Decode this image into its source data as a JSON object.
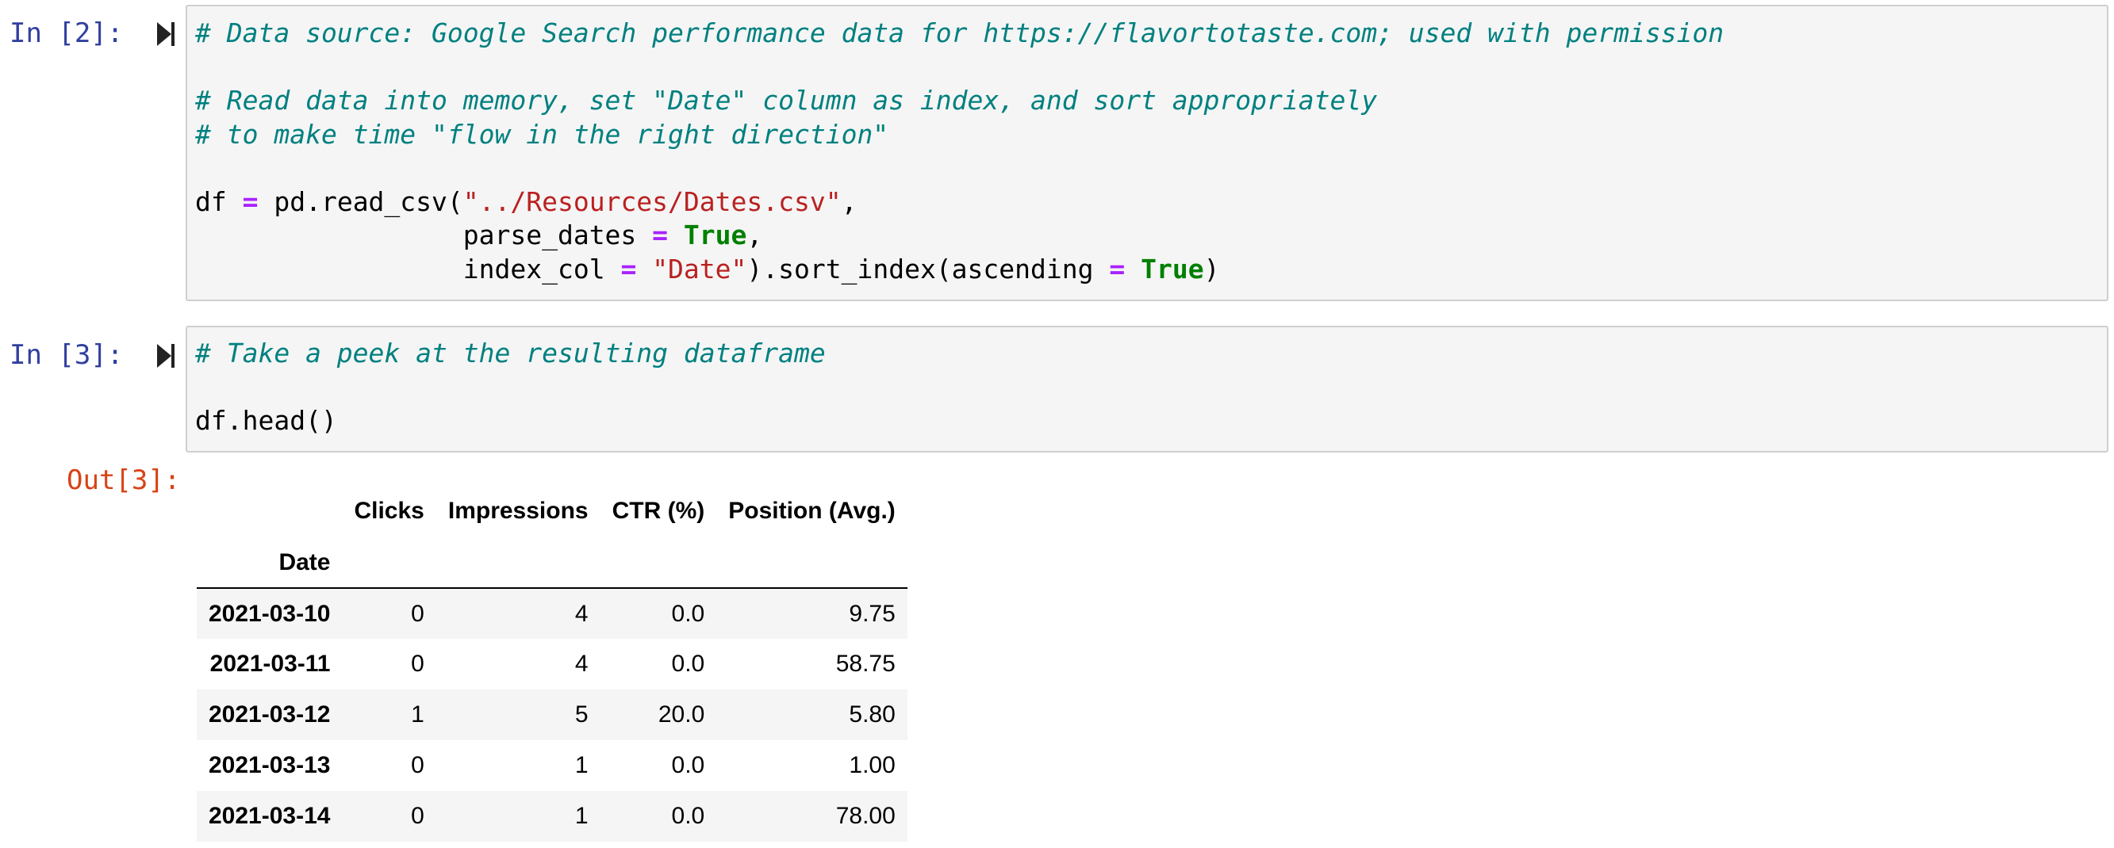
{
  "cells": [
    {
      "prompt": "In [2]:",
      "code_lines": [
        [
          {
            "cls": "cm",
            "text": "# Data source: Google Search performance data for https://flavortotaste.com; used with permission"
          }
        ],
        [],
        [
          {
            "cls": "cm",
            "text": "# Read data into memory, set \"Date\" column as index, and sort appropriately"
          }
        ],
        [
          {
            "cls": "cm",
            "text": "# to make time \"flow in the right direction\""
          }
        ],
        [],
        [
          {
            "cls": "",
            "text": "df "
          },
          {
            "cls": "op",
            "text": "="
          },
          {
            "cls": "",
            "text": " pd.read_csv("
          },
          {
            "cls": "st",
            "text": "\"../Resources/Dates.csv\""
          },
          {
            "cls": "",
            "text": ","
          }
        ],
        [
          {
            "cls": "",
            "text": "                 parse_dates "
          },
          {
            "cls": "op",
            "text": "="
          },
          {
            "cls": "",
            "text": " "
          },
          {
            "cls": "kw",
            "text": "True"
          },
          {
            "cls": "",
            "text": ","
          }
        ],
        [
          {
            "cls": "",
            "text": "                 index_col "
          },
          {
            "cls": "op",
            "text": "="
          },
          {
            "cls": "",
            "text": " "
          },
          {
            "cls": "st",
            "text": "\"Date\""
          },
          {
            "cls": "",
            "text": ").sort_index(ascending "
          },
          {
            "cls": "op",
            "text": "="
          },
          {
            "cls": "",
            "text": " "
          },
          {
            "cls": "kw",
            "text": "True"
          },
          {
            "cls": "",
            "text": ")"
          }
        ]
      ]
    },
    {
      "prompt": "In [3]:",
      "code_lines": [
        [
          {
            "cls": "cm",
            "text": "# Take a peek at the resulting dataframe"
          }
        ],
        [],
        [
          {
            "cls": "",
            "text": "df.head()"
          }
        ]
      ]
    }
  ],
  "output": {
    "prompt": "Out[3]:",
    "table": {
      "columns": [
        "Clicks",
        "Impressions",
        "CTR (%)",
        "Position (Avg.)"
      ],
      "index_name": "Date",
      "rows": [
        {
          "index": "2021-03-10",
          "values": [
            "0",
            "4",
            "0.0",
            "9.75"
          ]
        },
        {
          "index": "2021-03-11",
          "values": [
            "0",
            "4",
            "0.0",
            "58.75"
          ]
        },
        {
          "index": "2021-03-12",
          "values": [
            "1",
            "5",
            "20.0",
            "5.80"
          ]
        },
        {
          "index": "2021-03-13",
          "values": [
            "0",
            "1",
            "0.0",
            "1.00"
          ]
        },
        {
          "index": "2021-03-14",
          "values": [
            "0",
            "1",
            "0.0",
            "78.00"
          ]
        }
      ]
    }
  },
  "colors": {
    "in_prompt": "#303f9f",
    "out_prompt": "#d84315",
    "comment": "#008080",
    "string": "#ba2121",
    "keyword": "#008000",
    "operator": "#aa22ff",
    "cell_background": "#f5f5f5",
    "cell_border": "#cfcfcf"
  },
  "icons": {
    "run_button": "run-cell-icon"
  }
}
